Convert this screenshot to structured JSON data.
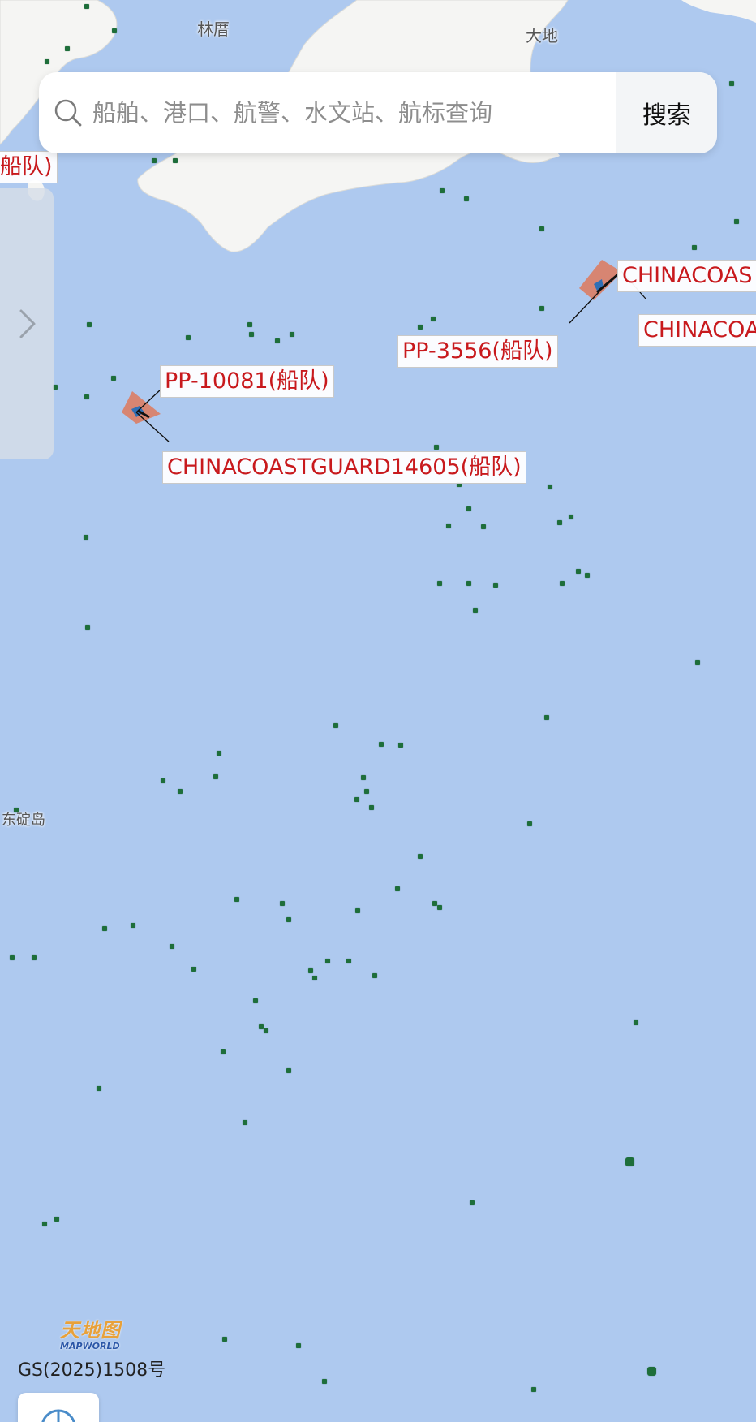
{
  "search": {
    "placeholder": "船舶、港口、航警、水文站、航标查询",
    "button_label": "搜索"
  },
  "places": {
    "linhu": "林厝",
    "dadi": "大地",
    "dongding": "东碇岛"
  },
  "vessel_labels": {
    "partial_left": "船队)",
    "pp10081": "PP-10081(船队)",
    "ccg14605": "CHINACOASTGUARD14605(船队)",
    "pp3556": "PP-3556(船队)",
    "ccg_top": "CHINACOAS",
    "ccg_second": "CHINACOA"
  },
  "footer": {
    "approval": "GS(2025)1508号",
    "logo_text": "天地图",
    "logo_subtext": "MAPWORLD"
  },
  "colors": {
    "sea": "#aec9ef",
    "land": "#f5f5f3",
    "vessel_label": "#c8191d",
    "ais_dot": "#1e6e3a"
  },
  "icons": {
    "search": "search-icon",
    "drawer": "chevron-right-icon",
    "locate": "compass-icon"
  }
}
